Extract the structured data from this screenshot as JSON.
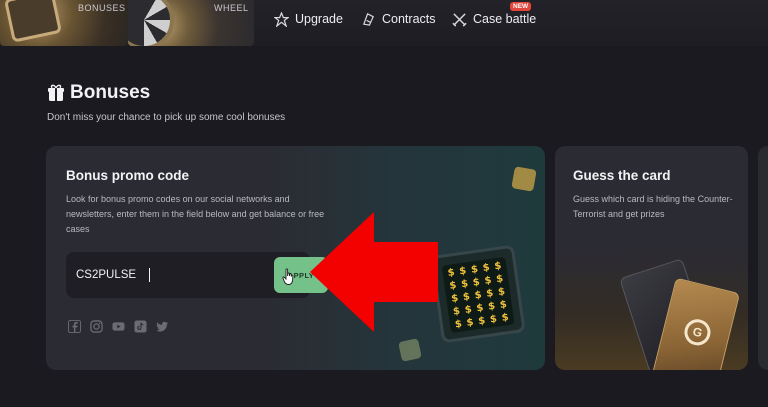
{
  "nav": {
    "thumbs": {
      "bonuses_label": "BONUSES",
      "wheel_label": "WHEEL"
    },
    "items": {
      "upgrade": "Upgrade",
      "contracts": "Contracts",
      "case_battle": "Case battle"
    },
    "new_badge": "NEW"
  },
  "page": {
    "title": "Bonuses",
    "subtitle": "Don't miss your chance to pick up some cool bonuses"
  },
  "promo": {
    "title": "Bonus promo code",
    "description": "Look for bonus promo codes on our social networks and newsletters, enter them in the field below and get balance or free cases",
    "input_value": "CS2PULSE",
    "apply_label": "APPLY",
    "socials": [
      "facebook-icon",
      "instagram-icon",
      "youtube-icon",
      "tiktok-icon",
      "twitter-icon"
    ]
  },
  "guess": {
    "title": "Guess the card",
    "description": "Guess which card is hiding the Counter-Terrorist and get prizes"
  },
  "colors": {
    "accent_green": "#74c28a",
    "arrow_red": "#f30000",
    "badge_red": "#e0463c",
    "background": "#1a1a20"
  }
}
